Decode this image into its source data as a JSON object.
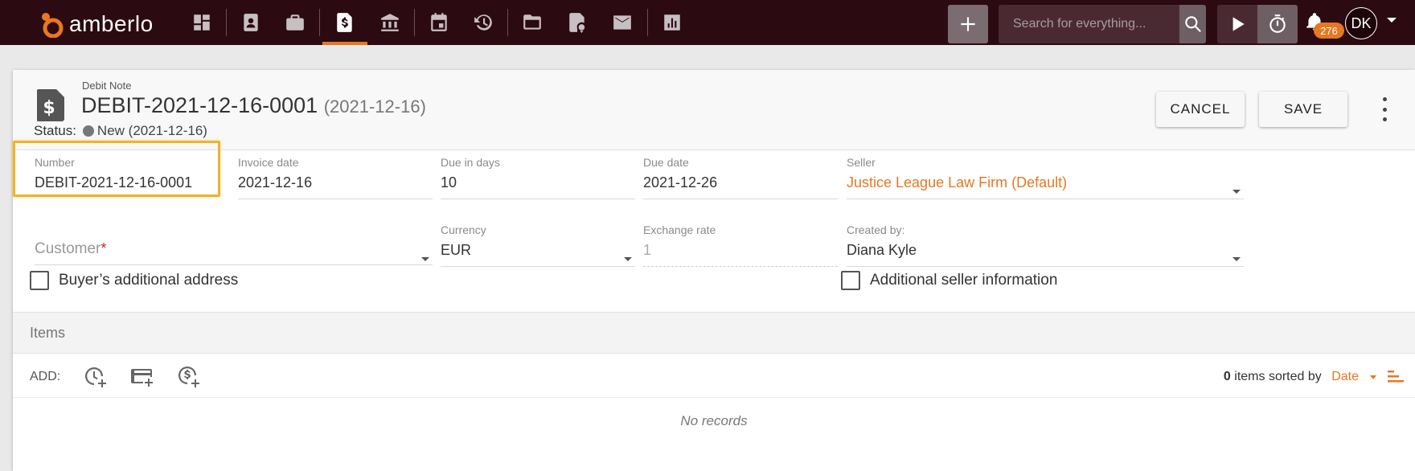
{
  "app": {
    "name": "amberlo"
  },
  "topbar": {
    "search_placeholder": "Search for everything...",
    "notifications_count": "276",
    "user_initials": "DK",
    "icons": [
      "dashboard-icon",
      "contacts-icon",
      "matters-icon",
      "invoice-icon",
      "bank-icon",
      "calendar-icon",
      "time-history-icon",
      "folder-icon",
      "certificate-icon",
      "mail-icon",
      "reports-icon"
    ],
    "active_icon": "invoice-icon"
  },
  "document": {
    "type": "Debit Note",
    "title": "DEBIT-2021-12-16-0001",
    "title_date": "(2021-12-16)",
    "status_label": "Status:",
    "status_value": "New (2021-12-16)",
    "cancel_label": "CANCEL",
    "save_label": "SAVE"
  },
  "fields": {
    "number": {
      "label": "Number",
      "value": "DEBIT-2021-12-16-0001"
    },
    "invoice_date": {
      "label": "Invoice date",
      "value": "2021-12-16"
    },
    "due_in_days": {
      "label": "Due in days",
      "value": "10"
    },
    "due_date": {
      "label": "Due date",
      "value": "2021-12-26"
    },
    "seller": {
      "label": "Seller",
      "value": "Justice League Law Firm (Default)"
    },
    "customer": {
      "placeholder": "Customer",
      "required_mark": "*"
    },
    "currency": {
      "label": "Currency",
      "value": "EUR"
    },
    "exchange_rate": {
      "label": "Exchange rate",
      "value": "1"
    },
    "created_by": {
      "label": "Created by:",
      "value": "Diana Kyle"
    }
  },
  "checkboxes": {
    "buyer_address": {
      "label": "Buyer’s additional address",
      "checked": false
    },
    "seller_info": {
      "label": "Additional seller information",
      "checked": false
    }
  },
  "items": {
    "section_title": "Items",
    "add_label": "ADD:",
    "count": "0",
    "sorted_by_text": "items sorted by",
    "sort_field": "Date",
    "empty_text": "No records"
  },
  "colors": {
    "accent": "#e87722",
    "topbar": "#2c0a12",
    "highlight": "#f0b429"
  }
}
